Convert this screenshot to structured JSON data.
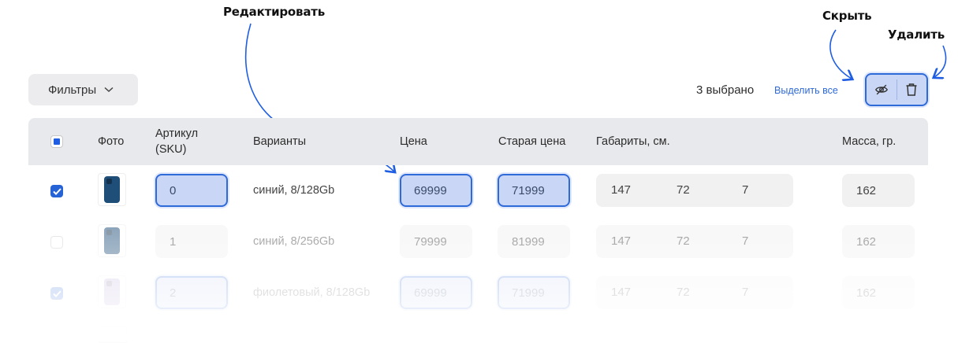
{
  "annotations": {
    "edit": "Редактировать",
    "hide": "Скрыть",
    "delete": "Удалить"
  },
  "toolbar": {
    "filters_label": "Фильтры",
    "selected_count": "3 выбрано",
    "select_all_label": "Выделить все",
    "hide_icon": "eye-off-icon",
    "delete_icon": "trash-icon"
  },
  "colors": {
    "accent": "#2f6ad9",
    "checkbox": "#2563d6",
    "active_input_bg": "#cad6f5",
    "header_bg": "#e8e9ec",
    "input_bg": "#f1f1f2"
  },
  "table": {
    "columns": {
      "photo": "Фото",
      "sku_line1": "Артикул",
      "sku_line2": "(SKU)",
      "variants": "Варианты",
      "price": "Цена",
      "old_price": "Старая цена",
      "dimensions": "Габариты, см.",
      "weight": "Масса, гр."
    },
    "rows": [
      {
        "checked": true,
        "sku": "0",
        "variant": "синий, 8/128Gb",
        "price": "69999",
        "old_price": "71999",
        "dim1": "147",
        "dim2": "72",
        "dim3": "7",
        "weight": "162",
        "phone_color": "#1f4e79"
      },
      {
        "checked": false,
        "sku": "1",
        "variant": "синий, 8/256Gb",
        "price": "79999",
        "old_price": "81999",
        "dim1": "147",
        "dim2": "72",
        "dim3": "7",
        "weight": "162",
        "phone_color": "#1f4e79"
      },
      {
        "checked": true,
        "sku": "2",
        "variant": "фиолетовый, 8/128Gb",
        "price": "69999",
        "old_price": "71999",
        "dim1": "147",
        "dim2": "72",
        "dim3": "7",
        "weight": "162",
        "phone_color": "#b7a6d9"
      }
    ]
  }
}
